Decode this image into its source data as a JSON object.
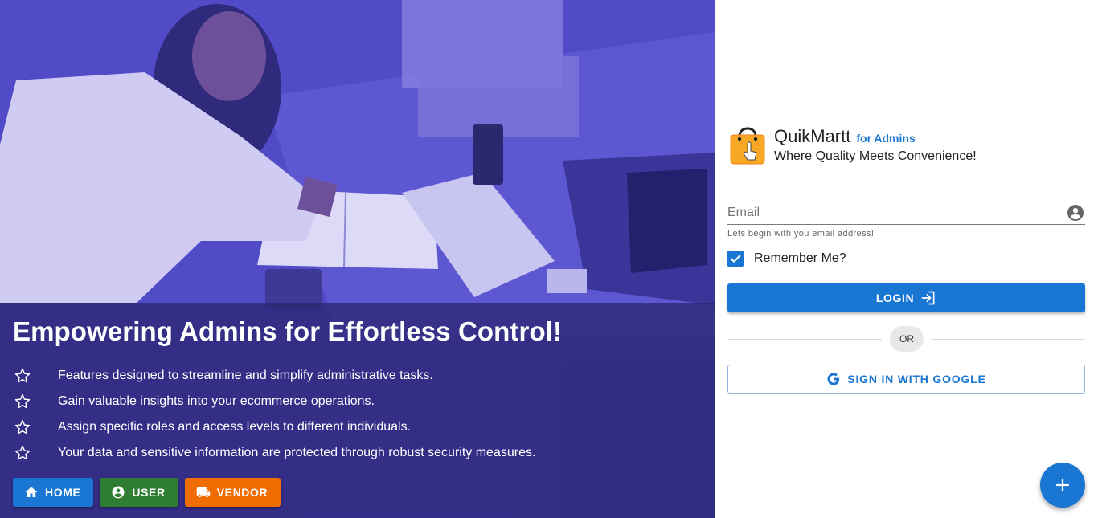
{
  "hero": {
    "title": "Empowering Admins for Effortless Control!",
    "features": [
      {
        "icon": "star-outline-icon",
        "text": "Features designed to streamline and simplify administrative tasks."
      },
      {
        "icon": "star-outline-icon",
        "text": "Gain valuable insights into your ecommerce operations."
      },
      {
        "icon": "star-outline-icon",
        "text": "Assign specific roles and access levels to different individuals."
      },
      {
        "icon": "star-outline-icon",
        "text": "Your data and sensitive information are protected through robust security measures."
      }
    ],
    "buttons": [
      {
        "label": "HOME",
        "icon": "home-icon",
        "color": "#1976d2"
      },
      {
        "label": "USER",
        "icon": "account-circle-icon",
        "color": "#2e7d32"
      },
      {
        "label": "VENDOR",
        "icon": "truck-icon",
        "color": "#ef6c00"
      }
    ]
  },
  "brand": {
    "logo_icon": "shopping-bag-icon",
    "name": "QuikMartt",
    "tag": "for Admins",
    "slogan": "Where Quality Meets Convenience!"
  },
  "form": {
    "email_placeholder": "Email",
    "email_value": "",
    "email_hint": "Lets begin with you email address!",
    "remember_label": "Remember Me?",
    "remember_checked": true,
    "login_label": "LOGIN",
    "or_label": "OR",
    "google_label": "SIGN IN WITH GOOGLE"
  },
  "fab": {
    "icon": "plus-icon"
  },
  "colors": {
    "primary": "#1976d2",
    "success": "#2e7d32",
    "warning": "#ef6c00",
    "hero_tint": "#4d47c2"
  }
}
